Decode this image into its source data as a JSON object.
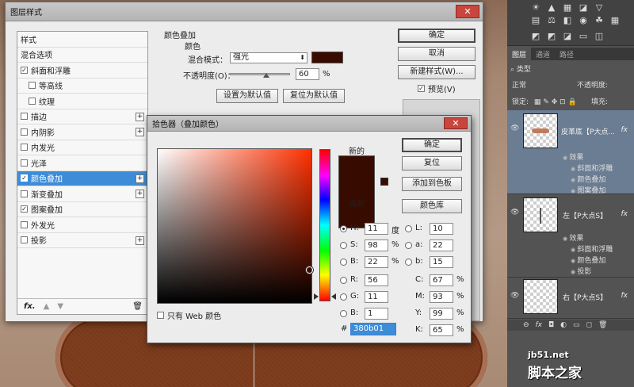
{
  "layer_style": {
    "title": "图层样式",
    "close": "✕",
    "effects": [
      {
        "label": "样式",
        "check": false,
        "sub": false,
        "plus": false,
        "plain": true
      },
      {
        "label": "混合选项",
        "check": false,
        "sub": false,
        "plus": false,
        "plain": true
      },
      {
        "label": "斜面和浮雕",
        "check": true,
        "sub": false,
        "plus": false
      },
      {
        "label": "等高线",
        "check": false,
        "sub": true,
        "plus": false
      },
      {
        "label": "纹理",
        "check": false,
        "sub": true,
        "plus": false
      },
      {
        "label": "描边",
        "check": false,
        "sub": false,
        "plus": true
      },
      {
        "label": "内阴影",
        "check": false,
        "sub": false,
        "plus": true
      },
      {
        "label": "内发光",
        "check": false,
        "sub": false,
        "plus": false
      },
      {
        "label": "光泽",
        "check": false,
        "sub": false,
        "plus": false
      },
      {
        "label": "颜色叠加",
        "check": true,
        "sub": false,
        "plus": true,
        "selected": true
      },
      {
        "label": "渐变叠加",
        "check": false,
        "sub": false,
        "plus": true
      },
      {
        "label": "图案叠加",
        "check": true,
        "sub": false,
        "plus": false
      },
      {
        "label": "外发光",
        "check": false,
        "sub": false,
        "plus": false
      },
      {
        "label": "投影",
        "check": false,
        "sub": false,
        "plus": true
      }
    ],
    "footer_fx": "fx.",
    "group_title": "颜色叠加",
    "group_sub": "颜色",
    "blend_mode_label": "混合模式：",
    "blend_mode_value": "强光",
    "opacity_label": "不透明度(O)：",
    "opacity_value": "60",
    "opacity_unit": "%",
    "opacity_level": 0.6,
    "set_default": "设置为默认值",
    "reset_default": "复位为默认值",
    "ok": "确定",
    "cancel": "取消",
    "new_style": "新建样式(W)...",
    "preview": "预览(V)"
  },
  "color_picker": {
    "title": "拾色器（叠加颜色）",
    "new_label": "新的",
    "current_label": "当前",
    "ok": "确定",
    "reset": "复位",
    "add_swatch": "添加到色板",
    "color_library": "颜色库",
    "hsb": [
      {
        "label": "H:",
        "value": "11",
        "unit": "度",
        "selected": true
      },
      {
        "label": "S:",
        "value": "98",
        "unit": "%",
        "selected": false
      },
      {
        "label": "B:",
        "value": "22",
        "unit": "%",
        "selected": false
      }
    ],
    "rgb": [
      {
        "label": "R:",
        "value": "56"
      },
      {
        "label": "G:",
        "value": "11"
      },
      {
        "label": "B:",
        "value": "1"
      }
    ],
    "lab": [
      {
        "label": "L:",
        "value": "10"
      },
      {
        "label": "a:",
        "value": "22"
      },
      {
        "label": "b:",
        "value": "15"
      }
    ],
    "cmyk": [
      {
        "label": "C:",
        "value": "67",
        "unit": "%"
      },
      {
        "label": "M:",
        "value": "93",
        "unit": "%"
      },
      {
        "label": "Y:",
        "value": "99",
        "unit": "%"
      },
      {
        "label": "K:",
        "value": "65",
        "unit": "%"
      }
    ],
    "web_only": "只有 Web 颜色",
    "hex_label": "#",
    "hex_value": "380b01"
  },
  "colors": {
    "overlay": "#380b01",
    "selection": "#3c8cd8"
  },
  "layers_panel": {
    "tabs": [
      "图层",
      "通道",
      "路径"
    ],
    "kind_label": "类型",
    "blend_mode": "正常",
    "opacity_label": "不透明度:",
    "lock_label": "锁定:",
    "fill_label": "填充:",
    "layers": [
      {
        "name": "皮革底【P大点...",
        "fx": "fx",
        "effects_label": "效果",
        "effects": [
          "斜面和浮雕",
          "颜色叠加",
          "图案叠加"
        ]
      },
      {
        "name": "左【P大点S】",
        "fx": "fx",
        "effects_label": "效果",
        "effects": [
          "斜面和浮雕",
          "颜色叠加",
          "投影"
        ]
      },
      {
        "name": "右【P大点S】",
        "fx": "fx",
        "effects_label": "",
        "effects": []
      }
    ]
  },
  "watermark": {
    "site": "jb51.net",
    "name": "脚本之家"
  }
}
